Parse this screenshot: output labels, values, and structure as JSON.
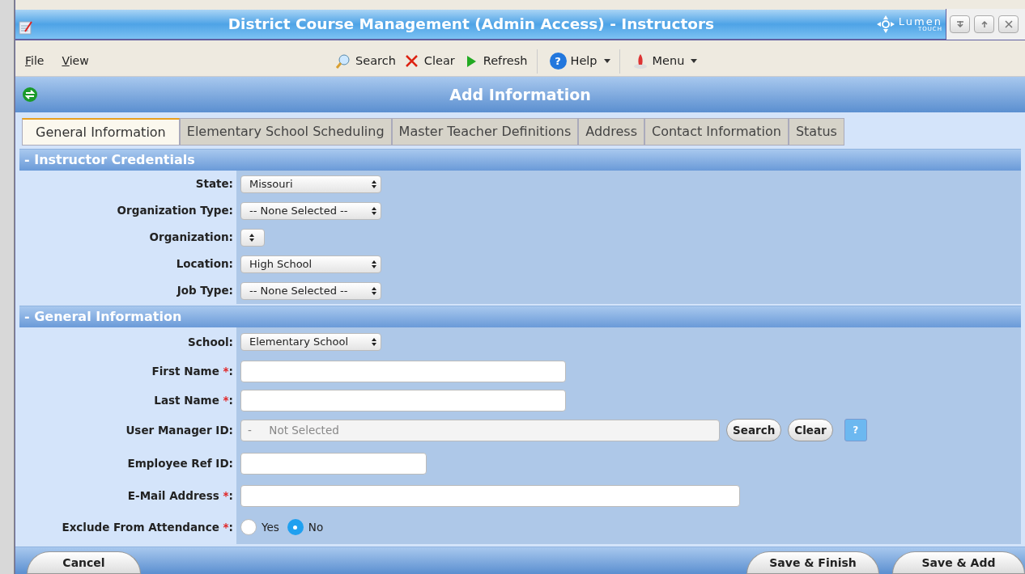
{
  "window": {
    "title": "District Course Management (Admin Access) - Instructors",
    "logo": {
      "name": "Lumen",
      "sub": "TOUCH"
    }
  },
  "menu_bar": [
    {
      "label": "File"
    },
    {
      "label": "View"
    }
  ],
  "toolbar": [
    {
      "kind": "search",
      "label": "Search"
    },
    {
      "kind": "clear",
      "label": "Clear"
    },
    {
      "kind": "refresh",
      "label": "Refresh"
    },
    {
      "kind": "help",
      "label": "Help",
      "glyph": "?",
      "dropdown": true
    },
    {
      "kind": "menu",
      "label": "Menu",
      "dropdown": true
    }
  ],
  "header": {
    "title": "Add Information"
  },
  "tabs": [
    {
      "label": "General Information",
      "selected": true
    },
    {
      "label": "Elementary School Scheduling",
      "selected": false
    },
    {
      "label": "Master Teacher Definitions",
      "selected": false
    },
    {
      "label": "Address",
      "selected": false
    },
    {
      "label": "Contact Information",
      "selected": false
    },
    {
      "label": "Status",
      "selected": false
    }
  ],
  "sections": [
    {
      "title": "- Instructor Credentials",
      "fields": [
        {
          "kind": "select",
          "label": "State:",
          "value": "Missouri"
        },
        {
          "kind": "select",
          "label": "Organization Type:",
          "value": "-- None Selected --"
        },
        {
          "kind": "select",
          "label": "Organization:"
        },
        {
          "kind": "select",
          "label": "Location:",
          "value": "High School"
        },
        {
          "kind": "select",
          "label": "Job Type:",
          "value": "-- None Selected --"
        }
      ]
    },
    {
      "title": "- General Information",
      "fields": [
        {
          "kind": "select",
          "label": "School:",
          "value": "Elementary School"
        },
        {
          "kind": "text",
          "label": "First Name ",
          "mark": "*",
          "suffix": ":"
        },
        {
          "kind": "text",
          "label": "Last Name ",
          "mark": "*",
          "suffix": ":"
        },
        {
          "kind": "lookup",
          "label": "User Manager ID:",
          "placeholder": "-     Not Selected",
          "buttons": [
            "Search",
            "Clear"
          ],
          "help": "?"
        },
        {
          "kind": "text",
          "label": "Employee Ref ID:"
        },
        {
          "kind": "text",
          "label": "E-Mail Address ",
          "mark": "*",
          "suffix": ":"
        },
        {
          "kind": "radio",
          "label": "Exclude From Attendance ",
          "mark": "*",
          "suffix": ":",
          "options": [
            {
              "label": "Yes",
              "selected": false
            },
            {
              "label": "No",
              "selected": true
            }
          ]
        }
      ]
    }
  ],
  "footer": {
    "left": [
      "Cancel"
    ],
    "right": [
      "Save & Finish",
      "Save & Add"
    ]
  }
}
